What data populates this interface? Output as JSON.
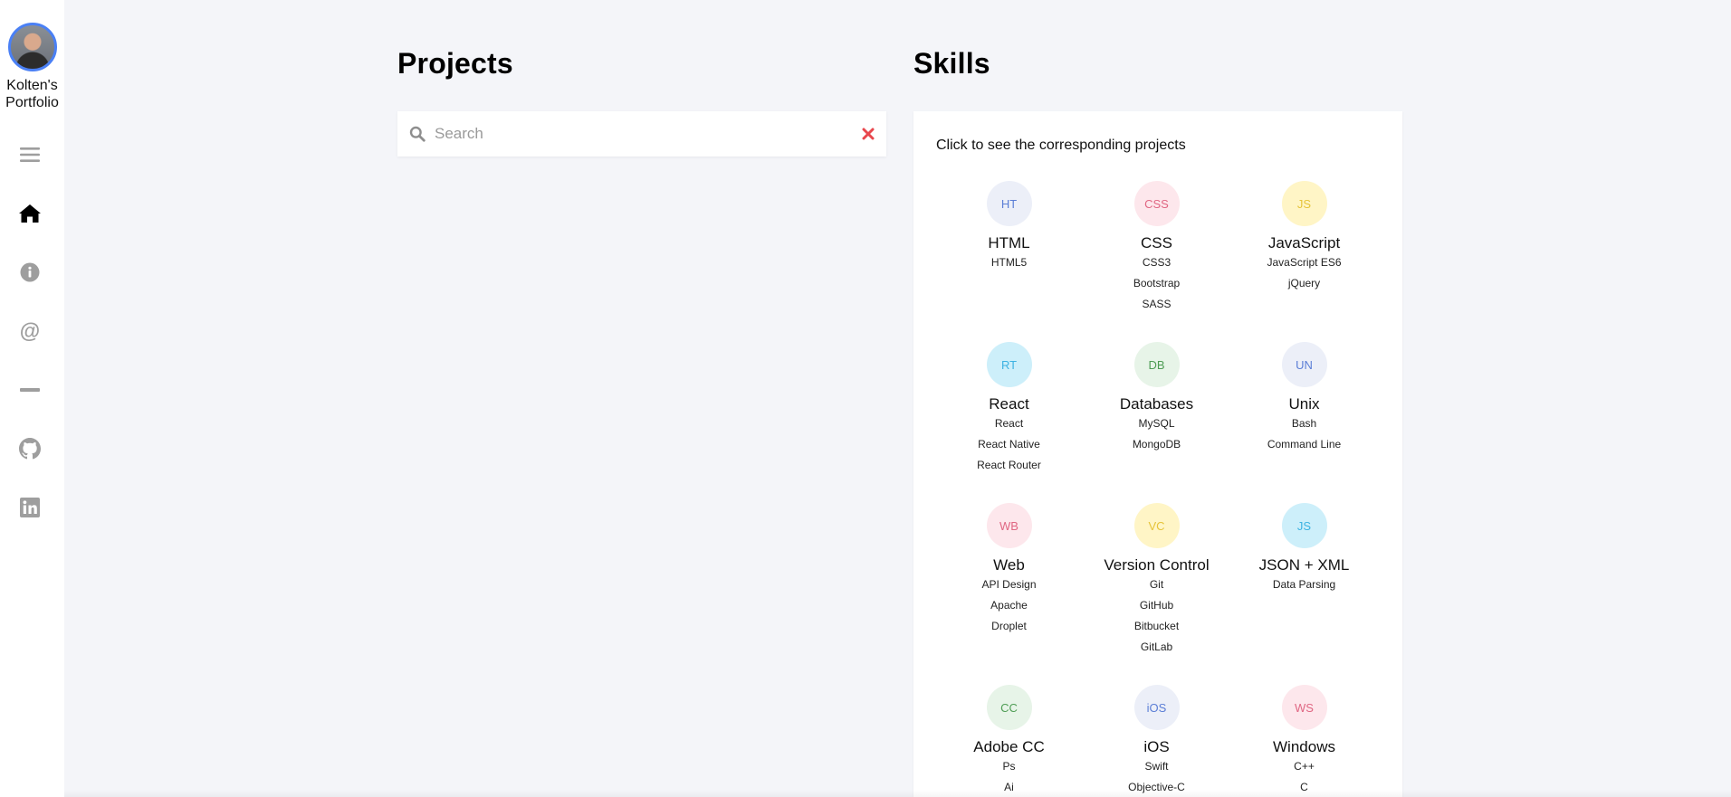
{
  "sidebar": {
    "brand_line1": "Kolten's",
    "brand_line2": "Portfolio",
    "icons": [
      "menu-icon",
      "home-icon",
      "info-icon",
      "at-icon",
      "dash-icon",
      "github-icon",
      "linkedin-icon"
    ],
    "active": "home-icon",
    "active_color": "#000000",
    "inactive_color": "#9e9e9e"
  },
  "projects": {
    "title": "Projects",
    "search": {
      "placeholder": "Search",
      "value": ""
    }
  },
  "skills": {
    "title": "Skills",
    "hint": "Click to see the corresponding projects",
    "items": [
      {
        "abbr": "HT",
        "name": "HTML",
        "subs": [
          "HTML5"
        ],
        "bg": "#eceff8",
        "fg": "#5b7ed6"
      },
      {
        "abbr": "CSS",
        "name": "CSS",
        "subs": [
          "CSS3",
          "Bootstrap",
          "SASS"
        ],
        "bg": "#fde7ec",
        "fg": "#e06783"
      },
      {
        "abbr": "JS",
        "name": "JavaScript",
        "subs": [
          "JavaScript ES6",
          "jQuery"
        ],
        "bg": "#fff5c6",
        "fg": "#e6c43a"
      },
      {
        "abbr": "RT",
        "name": "React",
        "subs": [
          "React",
          "React Native",
          "React Router"
        ],
        "bg": "#cdeffa",
        "fg": "#3db3e2"
      },
      {
        "abbr": "DB",
        "name": "Databases",
        "subs": [
          "MySQL",
          "MongoDB"
        ],
        "bg": "#e7f4e8",
        "fg": "#4f9d55"
      },
      {
        "abbr": "UN",
        "name": "Unix",
        "subs": [
          "Bash",
          "Command Line"
        ],
        "bg": "#eceff8",
        "fg": "#5b7ed6"
      },
      {
        "abbr": "WB",
        "name": "Web",
        "subs": [
          "API Design",
          "Apache",
          "Droplet"
        ],
        "bg": "#fde7ec",
        "fg": "#e06783"
      },
      {
        "abbr": "VC",
        "name": "Version Control",
        "subs": [
          "Git",
          "GitHub",
          "Bitbucket",
          "GitLab"
        ],
        "bg": "#fff5c6",
        "fg": "#e6c43a"
      },
      {
        "abbr": "JS",
        "name": "JSON + XML",
        "subs": [
          "Data Parsing"
        ],
        "bg": "#cdeffa",
        "fg": "#3db3e2"
      },
      {
        "abbr": "CC",
        "name": "Adobe CC",
        "subs": [
          "Ps",
          "Ai"
        ],
        "bg": "#e7f4e8",
        "fg": "#4f9d55"
      },
      {
        "abbr": "iOS",
        "name": "iOS",
        "subs": [
          "Swift",
          "Objective-C"
        ],
        "bg": "#eceff8",
        "fg": "#5b7ed6"
      },
      {
        "abbr": "WS",
        "name": "Windows",
        "subs": [
          "C++",
          "C"
        ],
        "bg": "#fde7ec",
        "fg": "#e06783"
      }
    ]
  },
  "colors": {
    "page_bg": "#f4f5f9",
    "avatar_ring": "#4a80f5",
    "clear_icon": "#e8474d"
  }
}
